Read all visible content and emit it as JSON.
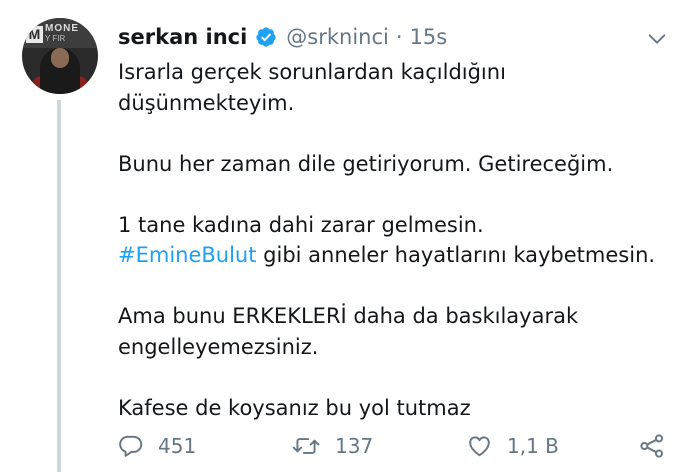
{
  "author": {
    "name": "serkan inci",
    "handle": "@srkninci",
    "separator": "·",
    "time": "15s",
    "verified": true,
    "avatar_logo_letter": "M",
    "avatar_logo_line1": "MONE",
    "avatar_logo_line2": "Y FIR"
  },
  "tweet": {
    "lines": [
      "Israrla gerçek sorunlardan kaçıldığını",
      "düşünmekteyim.",
      "Bunu her zaman dile getiriyorum. Getireceğim.",
      "1 tane kadına dahi zarar gelmesin.",
      "gibi anneler hayatlarını kaybetmesin.",
      "Ama bunu ERKEKLERİ daha da baskılayarak",
      "engelleyemezsiniz.",
      "Kafese de koysanız bu yol tutmaz"
    ],
    "hashtag": "#EmineBulut"
  },
  "actions": {
    "reply_count": "451",
    "retweet_count": "137",
    "like_count": "1,1 B"
  },
  "colors": {
    "link": "#1da1f2",
    "secondary_text": "#657786",
    "primary_text": "#14171a",
    "verified": "#1da1f2",
    "thread_line": "#ccd6dd"
  },
  "icons": {
    "verified": "verified-badge-icon",
    "caret": "chevron-down-icon",
    "reply": "reply-icon",
    "retweet": "retweet-icon",
    "like": "heart-icon",
    "share": "share-icon"
  }
}
